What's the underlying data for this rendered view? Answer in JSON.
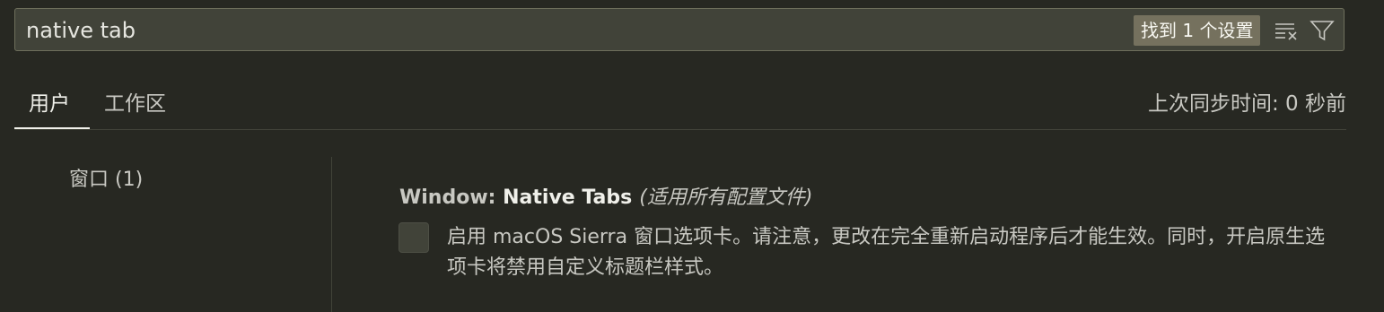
{
  "search": {
    "value": "native tab",
    "result_badge": "找到 1 个设置",
    "clear_icon": "clear-filter-icon",
    "filter_icon": "filter-icon"
  },
  "tabs": [
    {
      "label": "用户",
      "active": true
    },
    {
      "label": "工作区",
      "active": false
    }
  ],
  "sync_status": "上次同步时间: 0 秒前",
  "toc": {
    "items": [
      {
        "label": "窗口 (1)"
      }
    ]
  },
  "setting": {
    "category": "Window: ",
    "name": "Native Tabs",
    "scope": "(适用所有配置文件)",
    "checked": false,
    "description": "启用 macOS Sierra 窗口选项卡。请注意，更改在完全重新启动程序后才能生效。同时，开启原生选项卡将禁用自定义标题栏样式。"
  },
  "colors": {
    "background": "#272822",
    "search_bg": "#414339",
    "badge_bg": "#75715e",
    "text": "#c8c8c2",
    "text_strong": "#f0f0ea"
  }
}
